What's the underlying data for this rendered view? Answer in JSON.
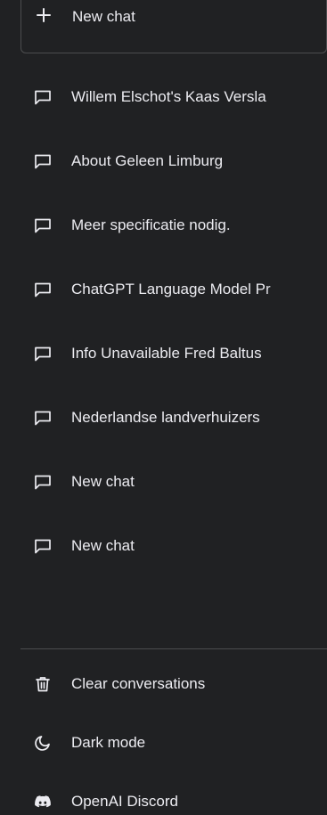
{
  "new_chat": {
    "label": "New chat",
    "icon": "plus-icon"
  },
  "history": [
    {
      "label": "Willem Elschot's Kaas Versla",
      "icon": "chat-bubble-icon"
    },
    {
      "label": "About Geleen Limburg",
      "icon": "chat-bubble-icon"
    },
    {
      "label": "Meer specificatie nodig.",
      "icon": "chat-bubble-icon"
    },
    {
      "label": "ChatGPT Language Model Pr",
      "icon": "chat-bubble-icon"
    },
    {
      "label": "Info Unavailable Fred Baltus",
      "icon": "chat-bubble-icon"
    },
    {
      "label": "Nederlandse landverhuizers",
      "icon": "chat-bubble-icon"
    },
    {
      "label": "New chat",
      "icon": "chat-bubble-icon"
    },
    {
      "label": "New chat",
      "icon": "chat-bubble-icon"
    }
  ],
  "bottom": {
    "clear": {
      "label": "Clear conversations",
      "icon": "trash-icon"
    },
    "dark_mode": {
      "label": "Dark mode",
      "icon": "moon-icon"
    },
    "discord": {
      "label": "OpenAI Discord",
      "icon": "discord-icon"
    }
  },
  "colors": {
    "background": "#202123",
    "text": "#ececf1",
    "border": "#4d4d4f"
  }
}
